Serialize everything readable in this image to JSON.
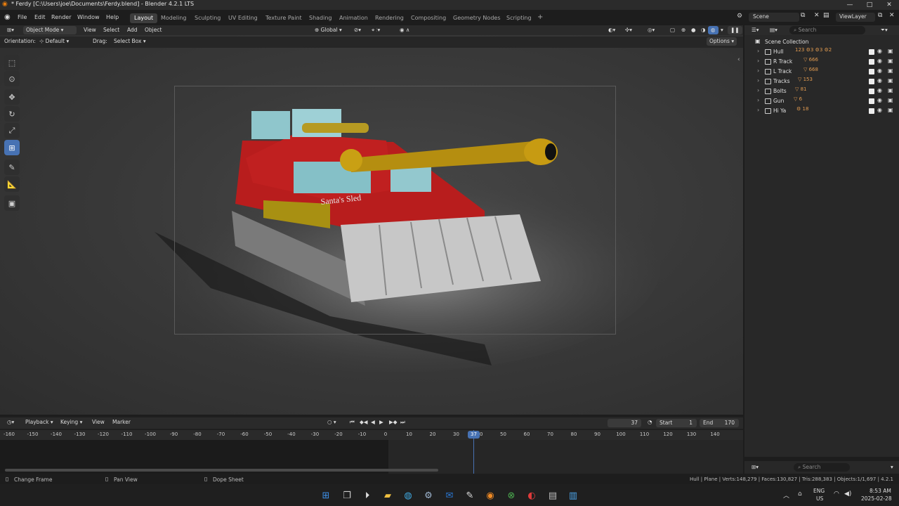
{
  "window": {
    "title": "* Ferdy [C:\\Users\\joe\\Documents\\Ferdy.blend] - Blender 4.2.1 LTS",
    "controls": [
      "—",
      "□",
      "✕"
    ]
  },
  "menu": [
    "File",
    "Edit",
    "Render",
    "Window",
    "Help"
  ],
  "workspaces": [
    "Layout",
    "Modeling",
    "Sculpting",
    "UV Editing",
    "Texture Paint",
    "Shading",
    "Animation",
    "Rendering",
    "Compositing",
    "Geometry Nodes",
    "Scripting"
  ],
  "workspace_add": "+",
  "scene": {
    "label": "Scene",
    "viewlayer": "ViewLayer"
  },
  "viewport_header": {
    "mode": "Object Mode",
    "menus": [
      "View",
      "Select",
      "Add",
      "Object"
    ],
    "transform": "Global",
    "orientation_label": "Orientation:",
    "orientation_value": "Default",
    "drag_label": "Drag:",
    "drag_value": "Select Box",
    "options": "Options"
  },
  "scene_content": {
    "sign_text": "Santa's Sled"
  },
  "outliner": {
    "search_placeholder": "Search",
    "root": "Scene Collection",
    "items": [
      {
        "name": "Hull",
        "mods": "123 ⚙3 ⚙3 ⚙2"
      },
      {
        "name": "R Track",
        "mods": "▽ 666"
      },
      {
        "name": "L Track",
        "mods": "▽ 668"
      },
      {
        "name": "Tracks",
        "mods": "▽ 153"
      },
      {
        "name": "Bolts",
        "mods": "▽ 81"
      },
      {
        "name": "Gun",
        "mods": "▽ 6"
      },
      {
        "name": "Hi Ya",
        "mods": "⚙ 18"
      }
    ]
  },
  "properties": {
    "search_placeholder": "Search"
  },
  "timeline": {
    "menus": [
      "Playback",
      "Keying",
      "View",
      "Marker"
    ],
    "current_frame": "37",
    "start_label": "Start",
    "start": "1",
    "end_label": "End",
    "end": "170",
    "ticks": [
      "-160",
      "-150",
      "-140",
      "-130",
      "-120",
      "-110",
      "-100",
      "-90",
      "-80",
      "-70",
      "-60",
      "-50",
      "-40",
      "-30",
      "-20",
      "-10",
      "0",
      "10",
      "20",
      "30",
      "40",
      "50",
      "60",
      "70",
      "80",
      "90",
      "100",
      "110",
      "120",
      "130",
      "140"
    ]
  },
  "statusbar": {
    "left": [
      "Change Frame",
      "Pan View",
      "Dope Sheet"
    ],
    "right": "Hull | Plane | Verts:148,279 | Faces:130,827 | Tris:288,383 | Objects:1/1,697 | 4.2.1"
  },
  "taskbar": {
    "lang": "ENG",
    "region": "US",
    "time": "8:53 AM",
    "date": "2025-02-28"
  }
}
